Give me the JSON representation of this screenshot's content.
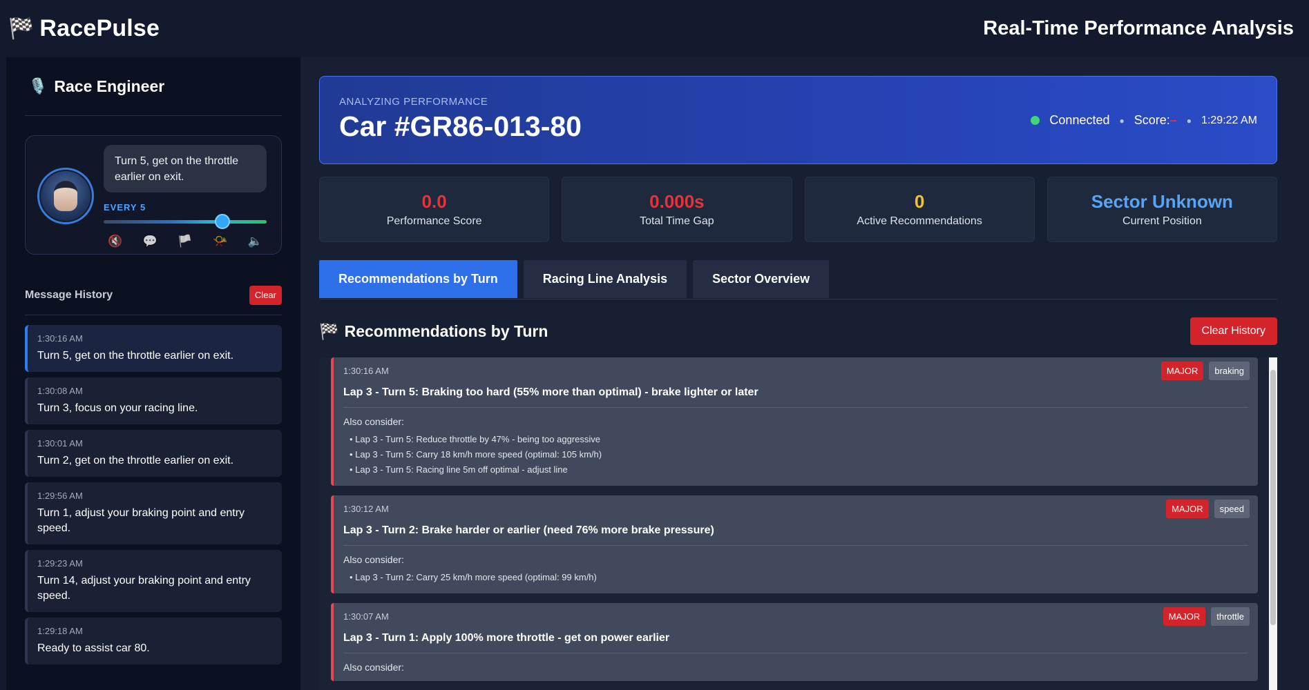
{
  "header": {
    "brand_icon": "checkered-flag",
    "brand_name": "RacePulse",
    "page_title": "Real-Time Performance Analysis"
  },
  "sidebar": {
    "engineer_icon": "microphone",
    "engineer_title": "Race Engineer",
    "current_message": "Turn 5, get on the throttle earlier on exit.",
    "frequency_label": "EVERY 5",
    "frequency_level": 0.73,
    "mode_icons": [
      "mute-icon",
      "chat-icon",
      "flag-icon",
      "megaphone-icon",
      "volume-off-icon"
    ],
    "history_label": "Message History",
    "clear_label": "Clear",
    "history": [
      {
        "time": "1:30:16 AM",
        "message": "Turn 5, get on the throttle earlier on exit."
      },
      {
        "time": "1:30:08 AM",
        "message": "Turn 3, focus on your racing line."
      },
      {
        "time": "1:30:01 AM",
        "message": "Turn 2, get on the throttle earlier on exit."
      },
      {
        "time": "1:29:56 AM",
        "message": "Turn 1, adjust your braking point and entry speed."
      },
      {
        "time": "1:29:23 AM",
        "message": "Turn 14, adjust your braking point and entry speed."
      },
      {
        "time": "1:29:18 AM",
        "message": "Ready to assist car 80."
      }
    ]
  },
  "hero": {
    "subtitle": "ANALYZING PERFORMANCE",
    "car": "Car #GR86-013-80",
    "connection": "Connected",
    "score_label": "Score:",
    "score_value": "–",
    "time": "1:29:22 AM"
  },
  "stats": [
    {
      "value": "0.0",
      "label": "Performance Score"
    },
    {
      "value": "0.000s",
      "label": "Total Time Gap"
    },
    {
      "value": "0",
      "label": "Active Recommendations"
    },
    {
      "value": "Sector Unknown",
      "label": "Current Position"
    }
  ],
  "tabs": [
    "Recommendations by Turn",
    "Racing Line Analysis",
    "Sector Overview"
  ],
  "recommendations": {
    "title": "Recommendations by Turn",
    "clear_label": "Clear History",
    "also_label": "Also consider:",
    "items": [
      {
        "time": "1:30:16 AM",
        "severity": "MAJOR",
        "category": "braking",
        "headline": "Lap 3 - Turn 5: Braking too hard (55% more than optimal) - brake lighter or later",
        "also": [
          "Lap 3 - Turn 5: Reduce throttle by 47% - being too aggressive",
          "Lap 3 - Turn 5: Carry 18 km/h more speed (optimal: 105 km/h)",
          "Lap 3 - Turn 5: Racing line 5m off optimal - adjust line"
        ]
      },
      {
        "time": "1:30:12 AM",
        "severity": "MAJOR",
        "category": "speed",
        "headline": "Lap 3 - Turn 2: Brake harder or earlier (need 76% more brake pressure)",
        "also": [
          "Lap 3 - Turn 2: Carry 25 km/h more speed (optimal: 99 km/h)"
        ]
      },
      {
        "time": "1:30:07 AM",
        "severity": "MAJOR",
        "category": "throttle",
        "headline": "Lap 3 - Turn 1: Apply 100% more throttle - get on power earlier",
        "also": []
      }
    ]
  }
}
